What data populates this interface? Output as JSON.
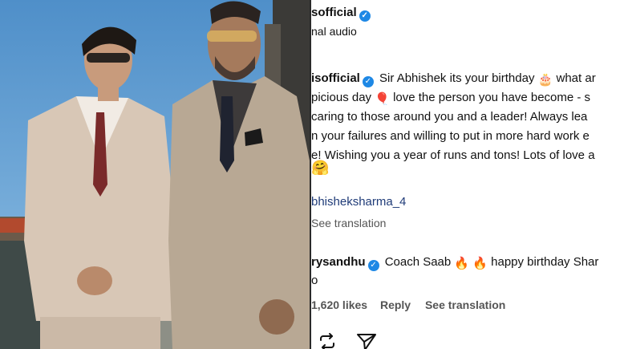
{
  "post_header": {
    "username": "sofficial",
    "subtitle": "nal audio"
  },
  "caption": {
    "username": "isofficial",
    "line1": "Sir Abhishek its your birthday",
    "line1_tail": "what ar",
    "line2_start": "picious day",
    "line2_tail": "love the person you have become - s",
    "line3": "caring to those around you and a leader! Always lea",
    "line4": "n your failures and willing to put in more hard work e",
    "line5": "e! Wishing you a year of runs and tons! Lots of love a",
    "mention": "bhisheksharma_4",
    "see_translation": "See translation"
  },
  "comment": {
    "username": "rysandhu",
    "text_start": "Coach Saab",
    "text_tail": "happy birthday Shar",
    "line2": "o",
    "likes": "1,620 likes",
    "reply": "Reply",
    "see_translation": "See translation"
  },
  "icons": [
    "verified-badge-icon",
    "birthday-cake-emoji",
    "balloon-emoji",
    "hugging-emoji",
    "fire-emoji",
    "repost-icon",
    "share-icon"
  ],
  "colors": {
    "link": "#1f3b78",
    "verified": "#1e88e5",
    "text": "#111111",
    "secondary": "#555555"
  }
}
